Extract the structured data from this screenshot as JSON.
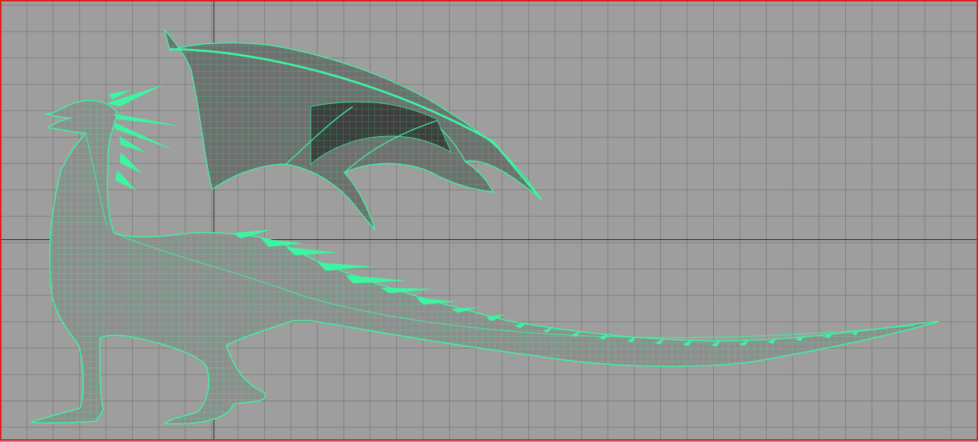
{
  "viewport": {
    "panel": "front-orthographic",
    "frame_color": "#e01b1b",
    "background_color": "#9e9e9e",
    "grid_color": "#7d7d7d",
    "axis_color": "#1c1c1c",
    "grid": true
  },
  "model": {
    "subject": "dragon",
    "display_mode": "wireframe-on-shaded",
    "wire_color": "#3df5a0",
    "shade_color": "#8e8e8e"
  }
}
